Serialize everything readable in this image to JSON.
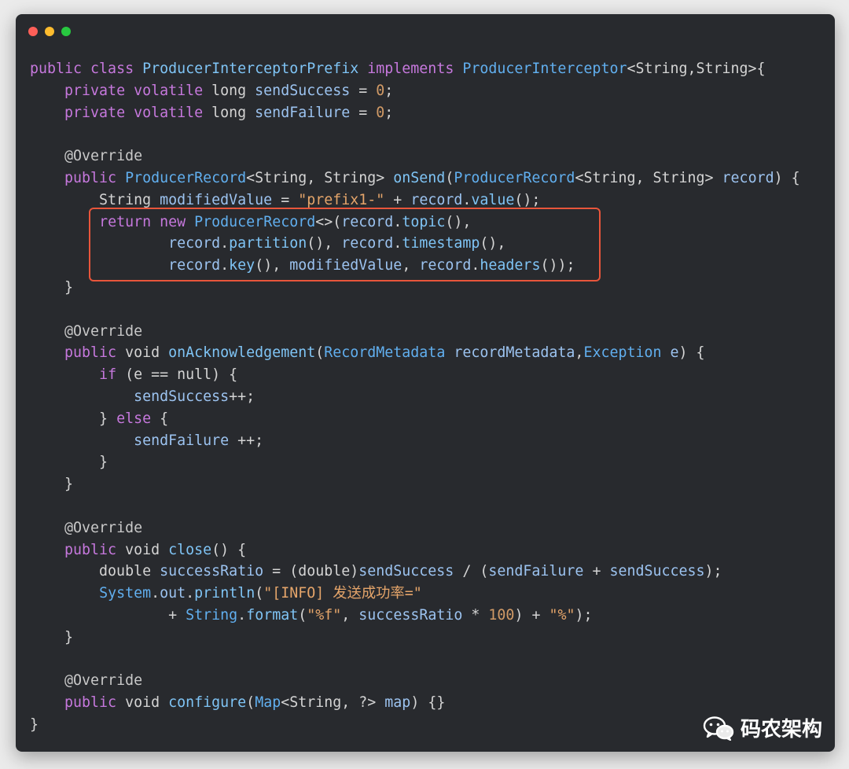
{
  "window": {
    "controls": [
      "close",
      "minimize",
      "maximize"
    ]
  },
  "code_lines": [
    [
      [
        "kw",
        "public "
      ],
      [
        "kw",
        "class "
      ],
      [
        "fn",
        "ProducerInterceptorPrefix "
      ],
      [
        "kw",
        "implements "
      ],
      [
        "ty",
        "ProducerInterceptor"
      ],
      [
        "pl",
        "<String,String>{"
      ]
    ],
    [
      [
        "pl",
        "    "
      ],
      [
        "kw",
        "private volatile "
      ],
      [
        "pl",
        "long "
      ],
      [
        "var",
        "sendSuccess"
      ],
      [
        "pl",
        " = "
      ],
      [
        "num",
        "0"
      ],
      [
        "pl",
        ";"
      ]
    ],
    [
      [
        "pl",
        "    "
      ],
      [
        "kw",
        "private volatile "
      ],
      [
        "pl",
        "long "
      ],
      [
        "var",
        "sendFailure"
      ],
      [
        "pl",
        " = "
      ],
      [
        "num",
        "0"
      ],
      [
        "pl",
        ";"
      ]
    ],
    [],
    [
      [
        "pl",
        "    "
      ],
      [
        "an",
        "@Override"
      ]
    ],
    [
      [
        "pl",
        "    "
      ],
      [
        "kw",
        "public "
      ],
      [
        "ty",
        "ProducerRecord"
      ],
      [
        "pl",
        "<String, String> "
      ],
      [
        "fn",
        "onSend"
      ],
      [
        "pl",
        "("
      ],
      [
        "ty",
        "ProducerRecord"
      ],
      [
        "pl",
        "<String, String> "
      ],
      [
        "var",
        "record"
      ],
      [
        "pl",
        ") {"
      ]
    ],
    [
      [
        "pl",
        "        String "
      ],
      [
        "var",
        "modifiedValue"
      ],
      [
        "pl",
        " = "
      ],
      [
        "st",
        "\"prefix1-\""
      ],
      [
        "pl",
        " + "
      ],
      [
        "var",
        "record"
      ],
      [
        "pl",
        "."
      ],
      [
        "fn",
        "value"
      ],
      [
        "pl",
        "();"
      ]
    ],
    [
      [
        "pl",
        "        "
      ],
      [
        "kw",
        "return new "
      ],
      [
        "ty",
        "ProducerRecord"
      ],
      [
        "pl",
        "<>("
      ],
      [
        "var",
        "record"
      ],
      [
        "pl",
        "."
      ],
      [
        "fn",
        "topic"
      ],
      [
        "pl",
        "(),"
      ]
    ],
    [
      [
        "pl",
        "                "
      ],
      [
        "var",
        "record"
      ],
      [
        "pl",
        "."
      ],
      [
        "fn",
        "partition"
      ],
      [
        "pl",
        "(), "
      ],
      [
        "var",
        "record"
      ],
      [
        "pl",
        "."
      ],
      [
        "fn",
        "timestamp"
      ],
      [
        "pl",
        "(),"
      ]
    ],
    [
      [
        "pl",
        "                "
      ],
      [
        "var",
        "record"
      ],
      [
        "pl",
        "."
      ],
      [
        "fn",
        "key"
      ],
      [
        "pl",
        "(), "
      ],
      [
        "var",
        "modifiedValue"
      ],
      [
        "pl",
        ", "
      ],
      [
        "var",
        "record"
      ],
      [
        "pl",
        "."
      ],
      [
        "fn",
        "headers"
      ],
      [
        "pl",
        "());"
      ]
    ],
    [
      [
        "pl",
        "    }"
      ]
    ],
    [],
    [
      [
        "pl",
        "    "
      ],
      [
        "an",
        "@Override"
      ]
    ],
    [
      [
        "pl",
        "    "
      ],
      [
        "kw",
        "public "
      ],
      [
        "pl",
        "void "
      ],
      [
        "fn",
        "onAcknowledgement"
      ],
      [
        "pl",
        "("
      ],
      [
        "ty",
        "RecordMetadata "
      ],
      [
        "var",
        "recordMetadata"
      ],
      [
        "pl",
        ","
      ],
      [
        "ty",
        "Exception "
      ],
      [
        "var",
        "e"
      ],
      [
        "pl",
        ") {"
      ]
    ],
    [
      [
        "pl",
        "        "
      ],
      [
        "kw",
        "if "
      ],
      [
        "pl",
        "(e == null) {"
      ]
    ],
    [
      [
        "pl",
        "            "
      ],
      [
        "var",
        "sendSuccess"
      ],
      [
        "pl",
        "++;"
      ]
    ],
    [
      [
        "pl",
        "        } "
      ],
      [
        "kw",
        "else "
      ],
      [
        "pl",
        "{"
      ]
    ],
    [
      [
        "pl",
        "            "
      ],
      [
        "var",
        "sendFailure"
      ],
      [
        "pl",
        " ++;"
      ]
    ],
    [
      [
        "pl",
        "        }"
      ]
    ],
    [
      [
        "pl",
        "    }"
      ]
    ],
    [],
    [
      [
        "pl",
        "    "
      ],
      [
        "an",
        "@Override"
      ]
    ],
    [
      [
        "pl",
        "    "
      ],
      [
        "kw",
        "public "
      ],
      [
        "pl",
        "void "
      ],
      [
        "fn",
        "close"
      ],
      [
        "pl",
        "() {"
      ]
    ],
    [
      [
        "pl",
        "        double "
      ],
      [
        "var",
        "successRatio"
      ],
      [
        "pl",
        " = (double)"
      ],
      [
        "var",
        "sendSuccess"
      ],
      [
        "pl",
        " / ("
      ],
      [
        "var",
        "sendFailure"
      ],
      [
        "pl",
        " + "
      ],
      [
        "var",
        "sendSuccess"
      ],
      [
        "pl",
        ");"
      ]
    ],
    [
      [
        "pl",
        "        "
      ],
      [
        "ty",
        "System"
      ],
      [
        "pl",
        "."
      ],
      [
        "var",
        "out"
      ],
      [
        "pl",
        "."
      ],
      [
        "fn",
        "println"
      ],
      [
        "pl",
        "("
      ],
      [
        "st",
        "\"[INFO] 发送成功率=\""
      ]
    ],
    [
      [
        "pl",
        "                + "
      ],
      [
        "ty",
        "String"
      ],
      [
        "pl",
        "."
      ],
      [
        "fn",
        "format"
      ],
      [
        "pl",
        "("
      ],
      [
        "st",
        "\"%f\""
      ],
      [
        "pl",
        ", "
      ],
      [
        "var",
        "successRatio"
      ],
      [
        "pl",
        " * "
      ],
      [
        "num",
        "100"
      ],
      [
        "pl",
        ") + "
      ],
      [
        "st",
        "\"%\""
      ],
      [
        "pl",
        ");"
      ]
    ],
    [
      [
        "pl",
        "    }"
      ]
    ],
    [],
    [
      [
        "pl",
        "    "
      ],
      [
        "an",
        "@Override"
      ]
    ],
    [
      [
        "pl",
        "    "
      ],
      [
        "kw",
        "public "
      ],
      [
        "pl",
        "void "
      ],
      [
        "fn",
        "configure"
      ],
      [
        "pl",
        "("
      ],
      [
        "ty",
        "Map"
      ],
      [
        "pl",
        "<String, ?> "
      ],
      [
        "var",
        "map"
      ],
      [
        "pl",
        ") {}"
      ]
    ],
    [
      [
        "pl",
        "}"
      ]
    ]
  ],
  "highlight": {
    "label": "return-statement-highlight",
    "color": "#e8553b"
  },
  "watermark": {
    "text": "码农架构",
    "icon": "wechat-icon"
  },
  "colors": {
    "background": "#282a2e",
    "keyword": "#c678dd",
    "type": "#61afef",
    "string": "#e5a56a",
    "number": "#d19a66"
  }
}
